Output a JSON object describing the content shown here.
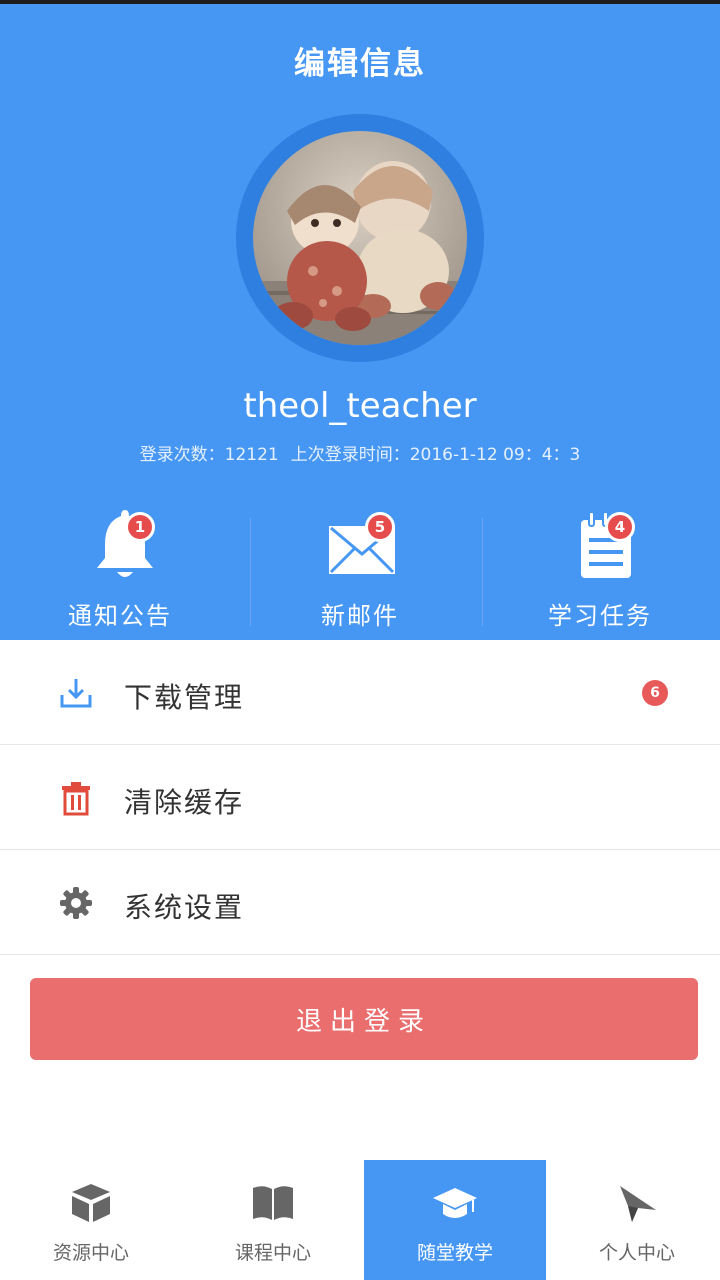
{
  "header": {
    "title": "编辑信息",
    "username": "theol_teacher",
    "login_count": "登录次数：12121",
    "last_login": "上次登录时间：2016-1-12 09：4：3"
  },
  "quick_actions": [
    {
      "label": "通知公告",
      "icon": "bell-icon",
      "badge": "1"
    },
    {
      "label": "新邮件",
      "icon": "mail-icon",
      "badge": "5"
    },
    {
      "label": "学习任务",
      "icon": "notepad-icon",
      "badge": "4"
    }
  ],
  "menu": [
    {
      "label": "下载管理",
      "icon": "download-icon",
      "badge": "6",
      "icon_color": "#4597f3"
    },
    {
      "label": "清除缓存",
      "icon": "trash-icon",
      "icon_color": "#e14b3b"
    },
    {
      "label": "系统设置",
      "icon": "gear-icon",
      "icon_color": "#666666"
    }
  ],
  "logout": {
    "label": "退出登录"
  },
  "bottom_nav": [
    {
      "label": "资源中心",
      "icon": "box-icon",
      "active": false
    },
    {
      "label": "课程中心",
      "icon": "book-icon",
      "active": false
    },
    {
      "label": "随堂教学",
      "icon": "graduation-cap-icon",
      "active": true
    },
    {
      "label": "个人中心",
      "icon": "paper-plane-icon",
      "active": false
    }
  ],
  "colors": {
    "primary": "#4597f3",
    "logout": "#eb6e6e",
    "badge": "#e74c4c"
  }
}
